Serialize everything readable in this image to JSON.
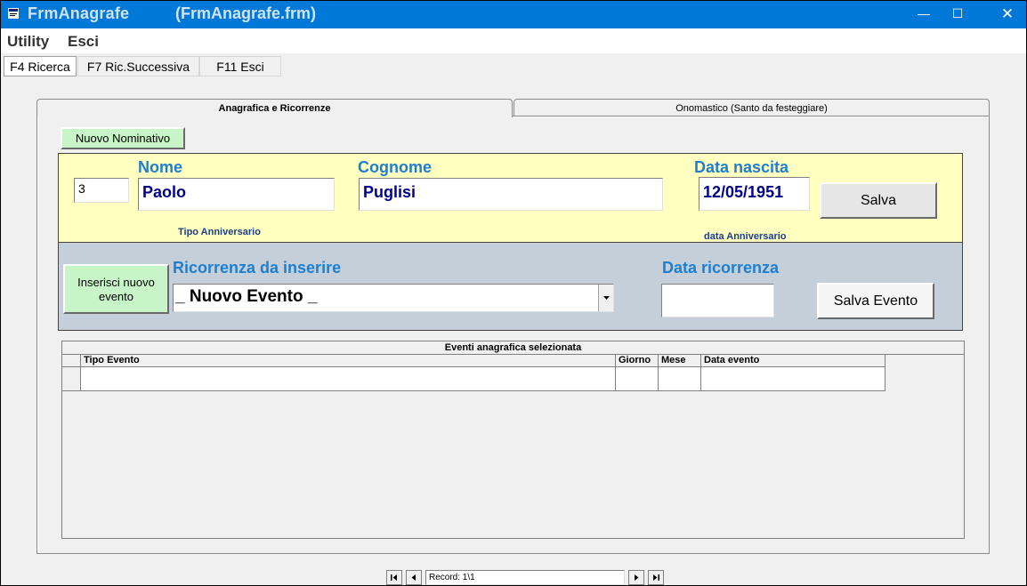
{
  "window": {
    "title": "FrmAnagrafe",
    "subtitle": "(FrmAnagrafe.frm)",
    "minimize": "—",
    "maximize": "☐",
    "close": "✕"
  },
  "menubar": {
    "items": [
      "Utility",
      "Esci"
    ]
  },
  "fkeys": [
    "F4 Ricerca",
    "F7 Ric.Successiva",
    "F11 Esci"
  ],
  "tabs": [
    "Anagrafica e Ricorrenze",
    "Onomastico (Santo da festeggiare)"
  ],
  "nuovo_button": "Nuovo Nominativo",
  "person": {
    "id": "3",
    "nome_label": "Nome",
    "nome": "Paolo",
    "cognome_label": "Cognome",
    "cognome": "Puglisi",
    "data_nascita_label": "Data nascita",
    "data_nascita": "12/05/1951",
    "salva_label": "Salva",
    "tipo_anniversario_label": "Tipo Anniversario",
    "data_anniversario_label": "data Anniversario"
  },
  "evento": {
    "inserisci_label": "Inserisci nuovo evento",
    "ricorrenza_label": "Ricorrenza da inserire",
    "ricorrenza_value": "_ Nuovo Evento _",
    "data_ricorrenza_label": "Data ricorrenza",
    "data_ricorrenza_value": "",
    "salva_evento_label": "Salva  Evento"
  },
  "grid": {
    "caption": "Eventi anagrafica selezionata",
    "columns": [
      "Tipo Evento",
      "Giorno",
      "Mese",
      "Data evento"
    ]
  },
  "navigator": {
    "record": "Record: 1\\1"
  },
  "colors": {
    "titlebar": "#0078d7",
    "yellow_panel": "#ffffc0",
    "blue_panel": "#c5cfda",
    "green_button": "#c8f5c8",
    "label_blue": "#1e7fd0"
  }
}
